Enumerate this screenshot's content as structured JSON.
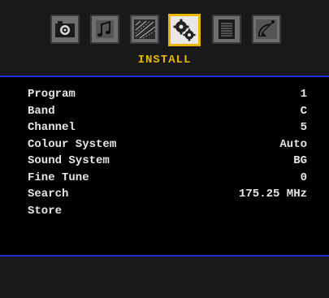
{
  "menu": {
    "title": "INSTALL",
    "tabs": [
      {
        "icon": "camera-icon",
        "selected": false
      },
      {
        "icon": "music-note-icon",
        "selected": false
      },
      {
        "icon": "picture-icon",
        "selected": false
      },
      {
        "icon": "install-gears-icon",
        "selected": true
      },
      {
        "icon": "document-icon",
        "selected": false
      },
      {
        "icon": "satellite-dish-icon",
        "selected": false
      }
    ]
  },
  "settings": [
    {
      "label": "Program",
      "value": "1"
    },
    {
      "label": "Band",
      "value": "C"
    },
    {
      "label": "Channel",
      "value": "5"
    },
    {
      "label": "Colour System",
      "value": "Auto"
    },
    {
      "label": "Sound System",
      "value": "BG"
    },
    {
      "label": "Fine Tune",
      "value": "0"
    },
    {
      "label": "Search",
      "value": "175.25 MHz"
    },
    {
      "label": "Store",
      "value": ""
    }
  ],
  "colors": {
    "accent": "#e6b800",
    "rule": "#1e2fd8",
    "text": "#e6e6e6"
  }
}
